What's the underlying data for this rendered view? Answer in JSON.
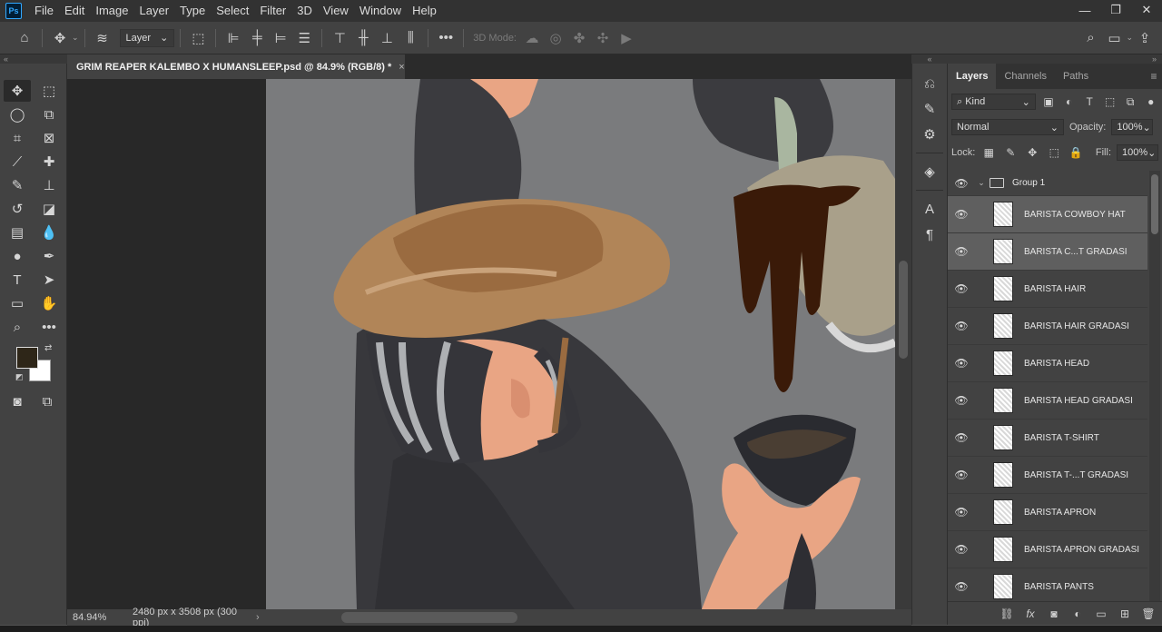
{
  "app": {
    "logo": "Ps"
  },
  "menu": [
    "File",
    "Edit",
    "Image",
    "Layer",
    "Type",
    "Select",
    "Filter",
    "3D",
    "View",
    "Window",
    "Help"
  ],
  "window_controls": {
    "minimize": "—",
    "restore": "❐",
    "close": "✕"
  },
  "options_bar": {
    "auto_select_value": "Layer",
    "mode_3d_label": "3D Mode:"
  },
  "document": {
    "tab_title": "GRIM REAPER KALEMBO X HUMANSLEEP.psd @ 84.9% (RGB/8) *",
    "close_glyph": "×"
  },
  "status": {
    "zoom": "84.94%",
    "dimensions": "2480 px x 3508 px (300 ppi)",
    "arrow": "›"
  },
  "panel": {
    "tabs": [
      "Layers",
      "Channels",
      "Paths"
    ],
    "filter_kind": "Kind",
    "blend_mode": "Normal",
    "opacity_label": "Opacity:",
    "opacity_value": "100%",
    "lock_label": "Lock:",
    "fill_label": "Fill:",
    "fill_value": "100%",
    "group_name": "Group 1",
    "layers": [
      {
        "name": "BARISTA COWBOY HAT",
        "selected": true
      },
      {
        "name": "BARISTA C...T GRADASI",
        "selected": true
      },
      {
        "name": "BARISTA HAIR",
        "selected": false
      },
      {
        "name": "BARISTA HAIR GRADASI",
        "selected": false
      },
      {
        "name": "BARISTA HEAD",
        "selected": false
      },
      {
        "name": "BARISTA HEAD GRADASI",
        "selected": false
      },
      {
        "name": "BARISTA T-SHIRT",
        "selected": false
      },
      {
        "name": "BARISTA T-...T GRADASI",
        "selected": false
      },
      {
        "name": "BARISTA APRON",
        "selected": false
      },
      {
        "name": "BARISTA APRON GRADASI",
        "selected": false
      },
      {
        "name": "BARISTA PANTS",
        "selected": false
      }
    ]
  },
  "colors": {
    "foreground": "#2e2618",
    "background": "#ffffff",
    "canvas_bg": "#7a7b7d"
  }
}
